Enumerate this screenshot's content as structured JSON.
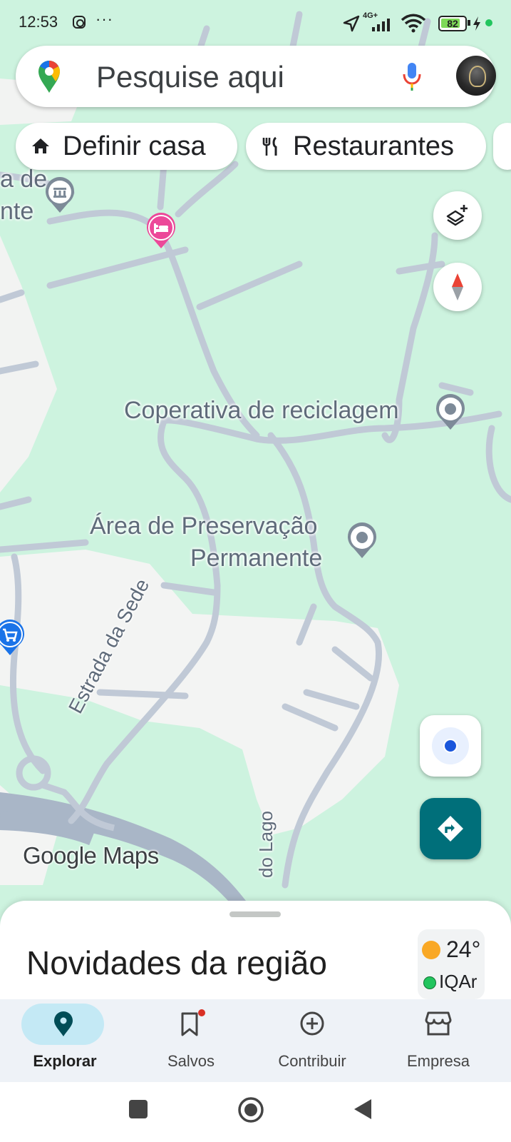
{
  "status_bar": {
    "time": "12:53",
    "more": "···",
    "network": "4G+",
    "battery": "82",
    "battery_level_percent": 82
  },
  "search": {
    "placeholder": "Pesquise aqui",
    "icons": [
      "maps-pin-icon",
      "mic-icon",
      "avatar"
    ]
  },
  "chips": [
    {
      "label": "Definir casa",
      "icon": "home-icon"
    },
    {
      "label": "Restaurantes",
      "icon": "fork-knife-icon"
    }
  ],
  "map": {
    "labels": {
      "partial_place_line1": "a de",
      "partial_place_line2": "nte",
      "cooperative": "Coperativa de reciclagem",
      "preserve_line1": "Área de Preservação",
      "preserve_line2": "Permanente",
      "road_sede": "Estrada da Sede",
      "road_lago": "do Lago"
    },
    "logo": "Google Maps",
    "colors": {
      "park": "#cdf3df",
      "urban": "#f2f3f2",
      "road": "#b7c2d0",
      "highway": "#9aa9bd",
      "poi_hotel": "#ec4899"
    }
  },
  "controls": [
    "layers-button",
    "compass-button",
    "my-location-button",
    "directions-button"
  ],
  "sheet": {
    "title": "Novidades da região",
    "weather": {
      "temp": "24°",
      "air_quality": "IQAr"
    }
  },
  "nav": {
    "items": [
      {
        "label": "Explorar",
        "icon": "explore-pin-icon",
        "active": true
      },
      {
        "label": "Salvos",
        "icon": "bookmark-icon",
        "active": false
      },
      {
        "label": "Contribuir",
        "icon": "add-circle-icon",
        "active": false
      },
      {
        "label": "Empresa",
        "icon": "storefront-icon",
        "active": false
      }
    ]
  },
  "accent": "#006f7a"
}
